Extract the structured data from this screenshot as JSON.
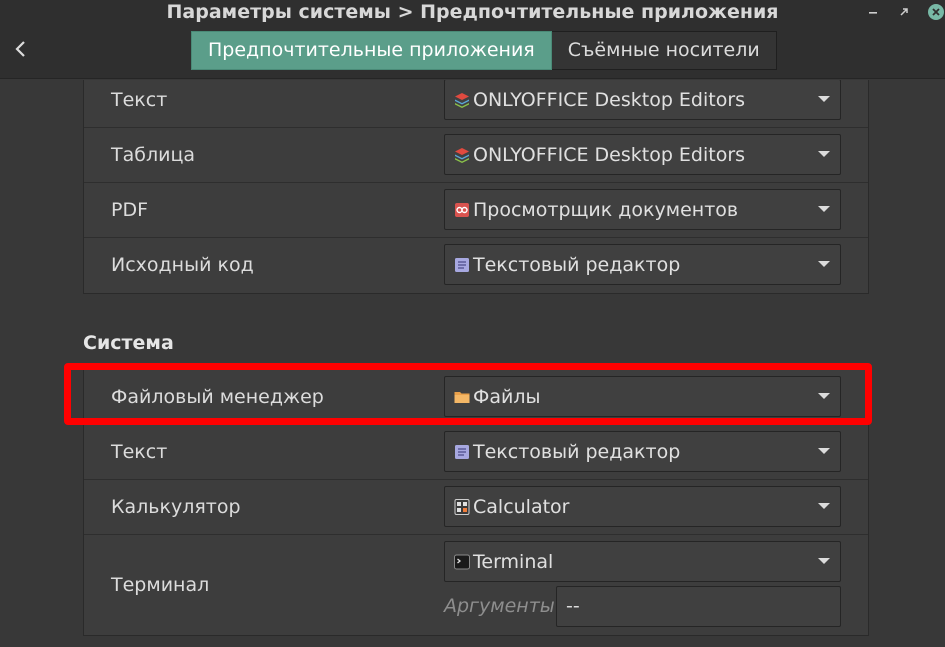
{
  "window": {
    "title": "Параметры системы > Предпочтительные приложения"
  },
  "tabs": [
    {
      "label": "Предпочтительные приложения",
      "active": true
    },
    {
      "label": "Съёмные носители",
      "active": false
    }
  ],
  "documents_group": {
    "rows": [
      {
        "label": "Текст",
        "app": "ONLYOFFICE Desktop Editors",
        "icon": "onlyoffice-icon"
      },
      {
        "label": "Таблица",
        "app": "ONLYOFFICE Desktop Editors",
        "icon": "onlyoffice-icon"
      },
      {
        "label": "PDF",
        "app": "Просмотрщик документов",
        "icon": "document-viewer-icon"
      },
      {
        "label": "Исходный код",
        "app": "Текстовый редактор",
        "icon": "text-editor-icon"
      }
    ]
  },
  "system_group": {
    "title": "Система",
    "rows": [
      {
        "label": "Файловый менеджер",
        "app": "Файлы",
        "icon": "folder-icon"
      },
      {
        "label": "Текст",
        "app": "Текстовый редактор",
        "icon": "text-editor-icon"
      },
      {
        "label": "Калькулятор",
        "app": "Calculator",
        "icon": "calculator-icon"
      },
      {
        "label": "Терминал",
        "app": "Terminal",
        "icon": "terminal-icon"
      }
    ],
    "arguments_label": "Аргументы",
    "arguments_value": "--"
  },
  "colors": {
    "accent": "#5b9e8a",
    "highlight": "#ff0000",
    "background": "#383838"
  }
}
